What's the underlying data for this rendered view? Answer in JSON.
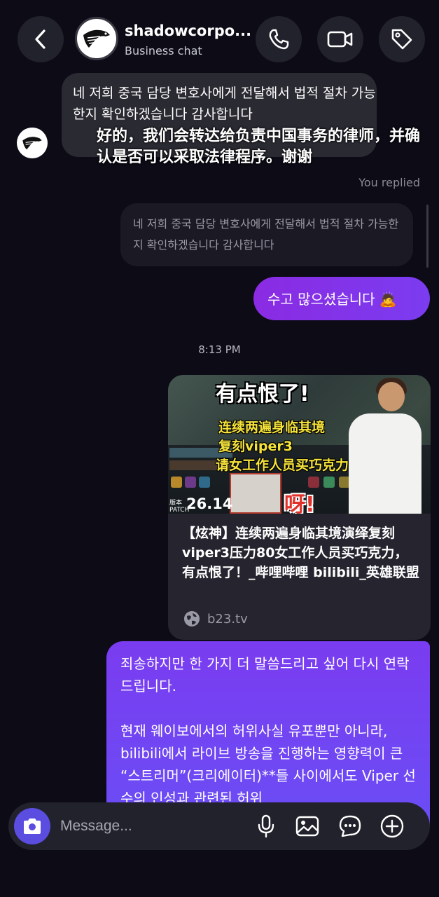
{
  "header": {
    "chat_name": "shadowcorpo...",
    "chat_subtitle": "Business chat"
  },
  "messages": {
    "incoming_text": "네 저희 중국 담당 변호사에게 전달해서 법적 절차 가능한지 확인하겠습니다 감사합니다",
    "incoming_translation": "好的，我们会转达给负责中国事务的律师，并确认是否可以采取法律程序。谢谢",
    "you_replied_label": "You replied",
    "quoted_text": "네 저희 중국 담당 변호사에게 전달해서 법적 절차 가능한지 확인하겠습니다 감사합니다",
    "reply_text": "수고 많으셨습니다 🙇",
    "timestamp": "8:13 PM",
    "link_card": {
      "thumb_title": "有点恨了!",
      "thumb_line1": "连续两遍身临其境",
      "thumb_line2": "复刻viper3",
      "thumb_line3": "请女工作人员买巧克力",
      "thumb_exclaim": "呀!",
      "patch_label": "版本 PATCH",
      "patch_number": "26.14",
      "title": "【炫神】连续两遍身临其境演绎复刻viper3压力80女工作人员买巧克力，有点恨了！_哔哩哔哩 bilibili_英雄联盟",
      "domain": "b23.tv"
    },
    "long_message_para1": "죄송하지만 한 가지 더 말씀드리고 싶어 다시 연락드립니다.",
    "long_message_para2": "현재 웨이보에서의 허위사실 유포뿐만 아니라, bilibili에서 라이브 방송을 진행하는 영향력이 큰 “스트리머”(크리에이터)**들 사이에서도 Viper 선수의 인성과 관련된 허위"
  },
  "composer": {
    "placeholder": "Message..."
  },
  "icons": {
    "back": "chevron-left-icon",
    "call": "phone-icon",
    "video": "video-camera-icon",
    "tag": "tag-icon",
    "camera": "camera-icon",
    "mic": "microphone-icon",
    "gallery": "image-icon",
    "sticker": "sticker-icon",
    "plus": "plus-circle-icon",
    "globe": "globe-icon"
  },
  "colors": {
    "background": "#0c0b16",
    "outgoing_bubble": "#7b3cf0",
    "incoming_bubble": "#2a2a33",
    "camera_button": "#5a4de0"
  }
}
